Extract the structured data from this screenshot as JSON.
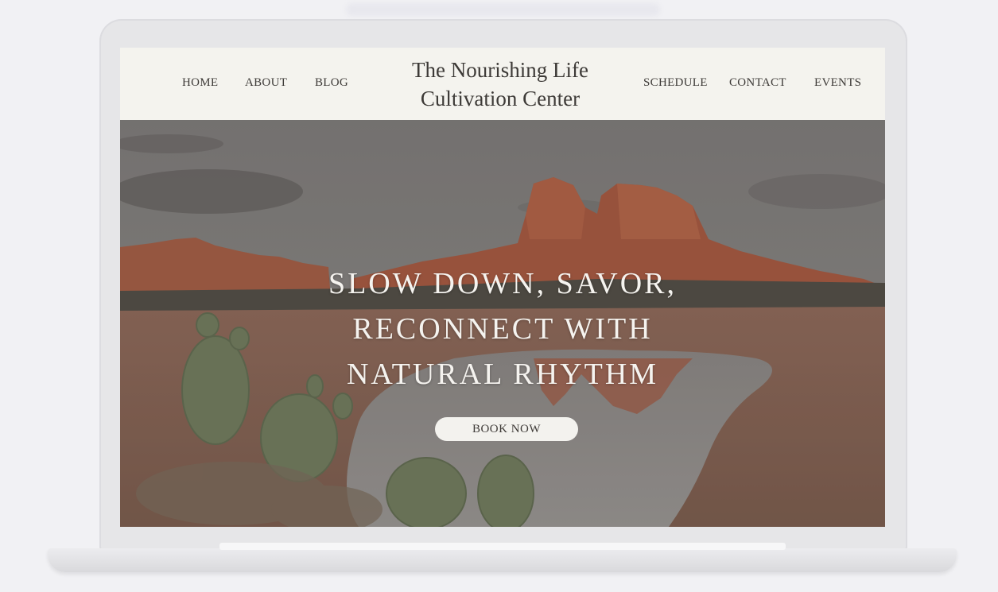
{
  "header": {
    "site_title_line1": "The Nourishing Life",
    "site_title_line2": "Cultivation Center",
    "nav_left": [
      "HOME",
      "ABOUT",
      "BLOG"
    ],
    "nav_right": [
      "SCHEDULE",
      "CONTACT",
      "EVENTS"
    ]
  },
  "hero": {
    "headline_line1": "SLOW DOWN, SAVOR,",
    "headline_line2": "RECONNECT WITH",
    "headline_line3": "NATURAL RHYTHM",
    "cta_label": "BOOK NOW",
    "image_subject": "red rock desert landscape with prickly pear cactus and reflecting pool"
  },
  "colors": {
    "header_bg": "#f4f3ee",
    "text_dark": "#3d3a37",
    "headline_text": "#f5f3ef",
    "button_bg": "#f3f2ee",
    "rock_red": "#a5533a"
  }
}
